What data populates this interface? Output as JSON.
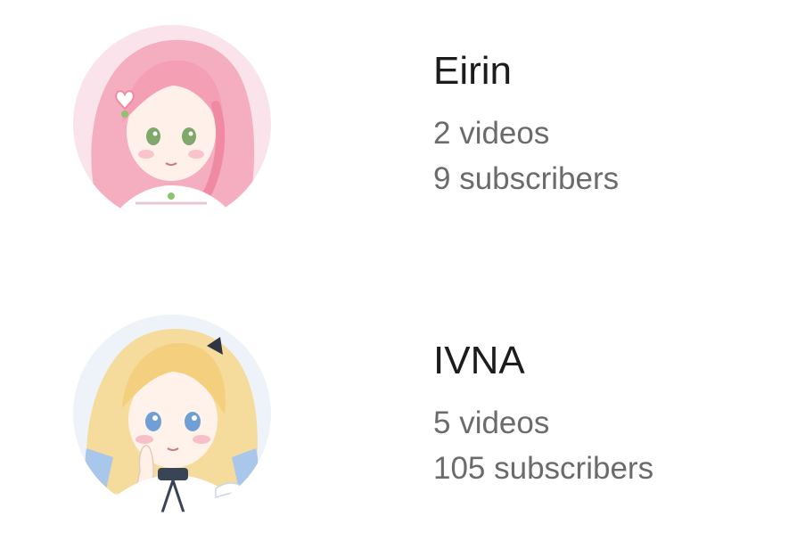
{
  "channels": [
    {
      "name": "Eirin",
      "videos": "2 videos",
      "subscribers": "9 subscribers"
    },
    {
      "name": "IVNA",
      "videos": "5 videos",
      "subscribers": "105 subscribers"
    }
  ],
  "colors": {
    "name_text": "#1c1c1e",
    "stat_text": "#6b6b6b",
    "background": "#ffffff"
  }
}
